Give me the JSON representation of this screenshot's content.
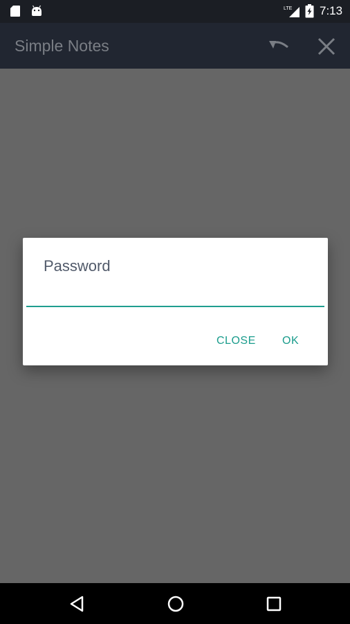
{
  "status_bar": {
    "time": "7:13",
    "network": "LTE",
    "icons": [
      "sd-card-icon",
      "android-icon",
      "lte-signal-icon",
      "battery-icon"
    ]
  },
  "app_bar": {
    "title": "Simple Notes",
    "actions": [
      "undo-icon",
      "close-icon"
    ]
  },
  "dialog": {
    "title": "Password",
    "input_value": "",
    "buttons": {
      "close": "CLOSE",
      "ok": "OK"
    }
  },
  "nav_bar": {
    "icons": [
      "back-icon",
      "home-icon",
      "recents-icon"
    ]
  },
  "colors": {
    "accent": "#1a9c8c",
    "app_bar": "#212631",
    "status_bar": "#1b1e24",
    "scrim": "#666666"
  }
}
